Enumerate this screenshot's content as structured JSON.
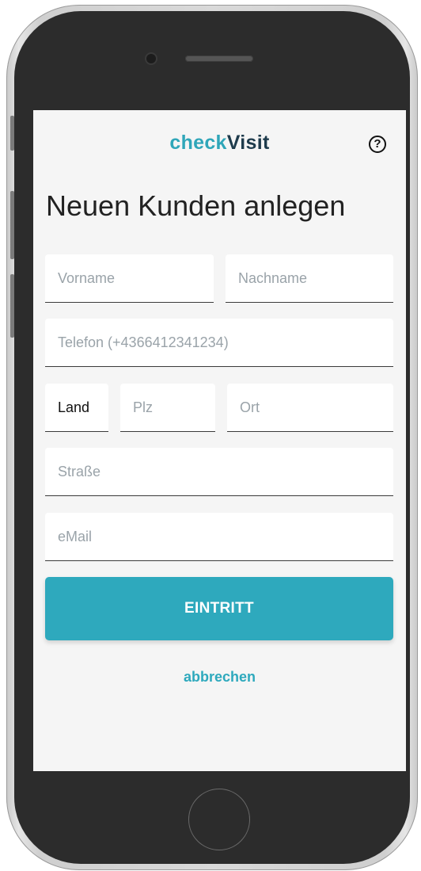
{
  "header": {
    "logo_part1": "check",
    "logo_part2": "Visit",
    "help_icon": "?"
  },
  "page": {
    "title": "Neuen Kunden anlegen"
  },
  "form": {
    "vorname_placeholder": "Vorname",
    "nachname_placeholder": "Nachname",
    "telefon_placeholder": "Telefon (+4366412341234)",
    "land_value": "Land",
    "plz_placeholder": "Plz",
    "ort_placeholder": "Ort",
    "strasse_placeholder": "Straße",
    "email_placeholder": "eMail"
  },
  "actions": {
    "submit_label": "EINTRITT",
    "cancel_label": "abbrechen"
  },
  "colors": {
    "accent": "#2ea9bd",
    "logo_dark": "#1e3b4c"
  }
}
